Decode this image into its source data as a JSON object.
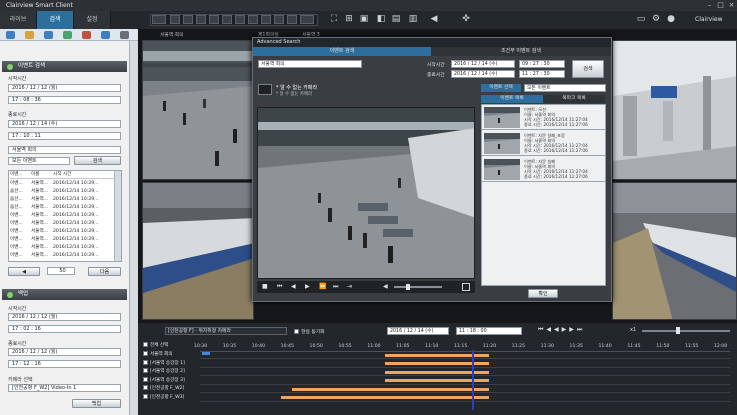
{
  "window": {
    "title": "Clairview Smart Client",
    "brand": "Clairview"
  },
  "tabs": [
    "라이브",
    "검색",
    "설정"
  ],
  "search_panel": {
    "event_header": "이벤트 검색",
    "start_label": "시작시간",
    "start_date": [
      "2016",
      "12",
      "12",
      "(월)"
    ],
    "start_time": [
      "17",
      "08",
      "36"
    ],
    "end_label": "종료시간",
    "end_date": [
      "2016",
      "12",
      "14",
      "(수)"
    ],
    "end_time": [
      "17",
      "10",
      "11"
    ],
    "camera_select": "서울역 회의",
    "event_select": "모든 이벤트",
    "search_button": "검색",
    "columns": [
      "이벤...",
      "이름",
      "시작 시간"
    ],
    "rows": [
      [
        "이벤...",
        "서울역...",
        "2016/12/14 10:29..."
      ],
      [
        "움션...",
        "서울역...",
        "2016/12/14 10:29..."
      ],
      [
        "움션...",
        "서울역...",
        "2016/12/14 10:29..."
      ],
      [
        "움션...",
        "서울역...",
        "2016/12/14 10:29..."
      ],
      [
        "이벤...",
        "서울역...",
        "2016/12/14 10:29..."
      ],
      [
        "이벤...",
        "서울역...",
        "2016/12/14 10:29..."
      ],
      [
        "이벤...",
        "서울역...",
        "2016/12/14 10:29..."
      ],
      [
        "이벤...",
        "서울역...",
        "2016/12/14 10:29..."
      ],
      [
        "이벤...",
        "서울역...",
        "2016/12/14 10:29..."
      ],
      [
        "이벤...",
        "서울역...",
        "2016/12/14 10:29..."
      ]
    ],
    "page_value": "50",
    "next_button": "다음"
  },
  "backup_panel": {
    "header": "백업",
    "start_label": "시작시간",
    "start_date": [
      "2016",
      "12",
      "12",
      "(월)"
    ],
    "start_time": [
      "17",
      "02",
      "16"
    ],
    "end_label": "종료시간",
    "end_date": [
      "2016",
      "12",
      "12",
      "(월)"
    ],
    "end_time": [
      "17",
      "12",
      "16"
    ],
    "camera_label": "카메라 선택",
    "camera_select": "[인천공항 F_W2] Video-In 1",
    "backup_button": "백업"
  },
  "camera_tabs": [
    "서울역 회의",
    "제1회의실",
    "서울역 3"
  ],
  "dialog": {
    "title": "Advanced Search",
    "tabs": [
      "이벤트 검색",
      "조건부 이벤트 검색"
    ],
    "camera": "서울역 회의",
    "start_label": "시작시간",
    "start_date": "2016 / 12 / 14 (수)",
    "start_time": "09 : 27 : 30",
    "end_label": "종료시간",
    "end_date": "2016 / 12 / 14 (수)",
    "end_time": "11 : 27 : 30",
    "search_button": "검색",
    "notice_title": "* 알 수 없는 카메라",
    "notice_sub": "* 알 수 없는 카메라",
    "result_tabs": [
      "이벤트 선택",
      "모든 이벤트"
    ],
    "list_tabs": [
      "이벤트 목록",
      "북마크 목록"
    ],
    "results": [
      [
        "이벤트: 모션",
        "이름: 서울역 회의",
        "시작 시간: 2016/12/14 11:27:04",
        "종료 시간: 2016/12/14 11:27:06"
      ],
      [
        "이벤트: 지문 실패_포함",
        "이름: 서울역 회의",
        "시작 시간: 2016/12/14 11:27:04",
        "종료 시간: 2016/12/14 11:27:06"
      ],
      [
        "이벤트: 지문 실패",
        "이름: 서울역 회의",
        "시작 시간: 2016/12/14 11:27:04",
        "종료 시간: 2016/12/14 11:27:06"
      ]
    ],
    "ok_button": "확인"
  },
  "timeline": {
    "camera_select": "[인천공항 F] - 위치취정 카메라",
    "option_label": "현실 동기화",
    "date": "2016 / 12 / 14 (수)",
    "time": "11 : 18 : 00",
    "speed": "x1",
    "all_select": "전체 선택",
    "ticks": [
      "10:30",
      "10:35",
      "10:40",
      "10:45",
      "10:50",
      "10:55",
      "11:00",
      "11:05",
      "11:10",
      "11:15",
      "11:20",
      "11:25",
      "11:30",
      "11:35",
      "11:40",
      "11:45",
      "11:50",
      "11:55",
      "12:00"
    ],
    "channels": [
      "서울역 회의",
      "[서울역 승강장 1]",
      "[서울역 승강장 2]",
      "[서울역 승강장 3]",
      "[인천공항 F_W2]",
      "[인천공항 F_W3]"
    ],
    "recordings": [
      {
        "start": "11:02",
        "end": "11:20"
      },
      {
        "start": "11:02",
        "end": "11:20"
      },
      {
        "start": "11:02",
        "end": "11:20"
      },
      {
        "start": "11:02",
        "end": "11:20"
      },
      {
        "start": "10:46",
        "end": "11:20"
      },
      {
        "start": "10:44",
        "end": "11:20"
      }
    ],
    "playhead": "11:17"
  }
}
